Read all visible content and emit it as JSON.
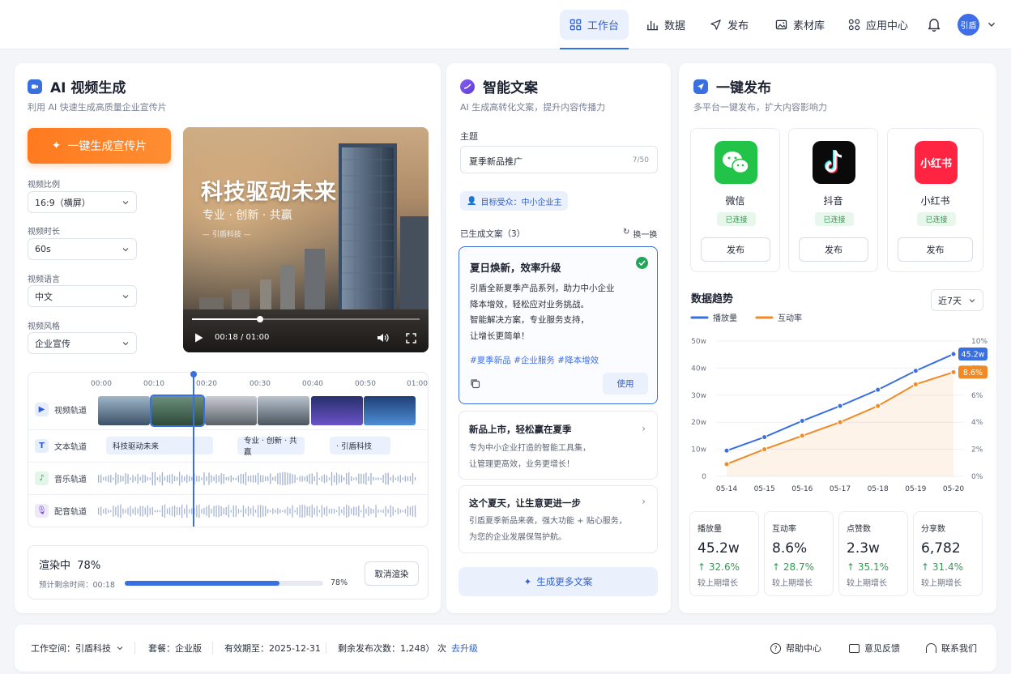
{
  "nav": {
    "items": [
      {
        "label": "工作台",
        "icon": "dashboard-icon",
        "active": true
      },
      {
        "label": "数据",
        "icon": "bar-chart-icon"
      },
      {
        "label": "发布",
        "icon": "send-icon"
      },
      {
        "label": "素材库",
        "icon": "image-icon"
      },
      {
        "label": "应用中心",
        "icon": "apps-icon"
      }
    ],
    "avatar": "引盾"
  },
  "video": {
    "title": "AI 视频生成",
    "subtitle": "利用 AI 快速生成高质量企业宣传片",
    "generate_label": "一键生成宣传片",
    "fields": [
      {
        "label": "视频比例",
        "value": "16:9（横屏）"
      },
      {
        "label": "视频时长",
        "value": "60s"
      },
      {
        "label": "视频语言",
        "value": "中文"
      },
      {
        "label": "视频风格",
        "value": "企业宣传"
      }
    ],
    "preview": {
      "title": "科技驱动未来",
      "subtitle": "专业 · 创新 · 共赢",
      "brand": "— 引盾科技 —",
      "time": "00:18 / 01:00",
      "progress": 0.3
    },
    "timeline": {
      "ticks": [
        "00:00",
        "00:10",
        "00:20",
        "00:30",
        "00:40",
        "00:50",
        "01:00"
      ],
      "tracks": [
        {
          "label": "视频轨道",
          "icon": "video-track-icon"
        },
        {
          "label": "文本轨道",
          "icon": "text-track-icon"
        },
        {
          "label": "音乐轨道",
          "icon": "music-track-icon"
        },
        {
          "label": "配音轨道",
          "icon": "mic-track-icon"
        }
      ],
      "text_clips": [
        "科技驱动未来",
        "专业 · 创新 · 共赢",
        "· 引盾科技"
      ],
      "playhead_time": 0.3
    },
    "render": {
      "status": "渲染中",
      "percent": "78%",
      "percent_value": 0.78,
      "remaining_label": "预计剩余时间：",
      "remaining": "00:18",
      "cancel_label": "取消渲染"
    }
  },
  "copy": {
    "title": "智能文案",
    "subtitle": "AI 生成高转化文案，提升内容传播力",
    "topic_label": "主题",
    "topic_value": "夏季新品推广",
    "topic_count": "7/50",
    "audience": "目标受众：中小企业主",
    "generated_label": "已生成文案（3）",
    "refresh_label": "换一换",
    "selected": {
      "title": "夏日焕新，效率升级",
      "lines": [
        "引盾全新夏季产品系列，助力中小企业",
        "降本增效，轻松应对业务挑战。",
        "智能解决方案，专业服务支持，",
        "让增长更简单！"
      ],
      "tags": "#夏季新品 #企业服务 #降本增效",
      "use_label": "使用"
    },
    "others": [
      {
        "title": "新品上市，轻松赢在夏季",
        "lines": [
          "专为中小企业打造的智能工具集，",
          "让管理更高效，业务更增长！"
        ]
      },
      {
        "title": "这个夏天，让生意更进一步",
        "lines": [
          "引盾夏季新品来袭，强大功能 + 贴心服务，",
          "为您的企业发展保驾护航。"
        ]
      }
    ],
    "more_label": "生成更多文案"
  },
  "publish": {
    "title": "一键发布",
    "subtitle": "多平台一键发布，扩大内容影响力",
    "platforms": [
      {
        "name": "微信",
        "status": "已连接",
        "button": "发布",
        "icon": "wechat-icon"
      },
      {
        "name": "抖音",
        "status": "已连接",
        "button": "发布",
        "icon": "douyin-icon"
      },
      {
        "name": "小红书",
        "status": "已连接",
        "button": "发布",
        "icon": "xiaohongshu-icon",
        "logo_text": "小红书"
      }
    ],
    "trend_title": "数据趋势",
    "range": "近7天",
    "stats": [
      {
        "label": "播放量",
        "value": "45.2w",
        "change": "↑ 32.6%",
        "caption": "较上期增长"
      },
      {
        "label": "互动率",
        "value": "8.6%",
        "change": "↑ 28.7%",
        "caption": "较上期增长"
      },
      {
        "label": "点赞数",
        "value": "2.3w",
        "change": "↑ 35.1%",
        "caption": "较上期增长"
      },
      {
        "label": "分享数",
        "value": "6,782",
        "change": "↑ 31.4%",
        "caption": "较上期增长"
      }
    ]
  },
  "chart_data": {
    "type": "line",
    "x": [
      "05-14",
      "05-15",
      "05-16",
      "05-17",
      "05-18",
      "05-19",
      "05-20"
    ],
    "series": [
      {
        "name": "播放量",
        "axis": "left",
        "color": "#3a6fe0",
        "values": [
          9.5,
          14.5,
          20.5,
          26,
          32,
          39,
          45.2
        ],
        "end_label": "45.2w"
      },
      {
        "name": "互动率",
        "axis": "right",
        "color": "#f08a24",
        "values": [
          0.9,
          2,
          3,
          4,
          5.2,
          6.8,
          7.7
        ],
        "end_label": "8.6%"
      }
    ],
    "y_left_ticks": [
      "0",
      "10w",
      "20w",
      "30w",
      "40w",
      "50w"
    ],
    "y_left_lim": [
      0,
      50
    ],
    "y_right_ticks": [
      "0%",
      "2%",
      "4%",
      "6%",
      "8%",
      "10%"
    ],
    "y_right_lim": [
      0,
      10
    ],
    "grid": true,
    "legend": "top-left"
  },
  "footer": {
    "workspace": "工作空间：引盾科技",
    "plan": "套餐：企业版",
    "expiry": "有效期至：2025-12-31",
    "remaining": "剩余发布次数：1,248） 次",
    "upgrade": "去升级",
    "help": "帮助中心",
    "feedback": "意见反馈",
    "contact": "联系我们"
  }
}
